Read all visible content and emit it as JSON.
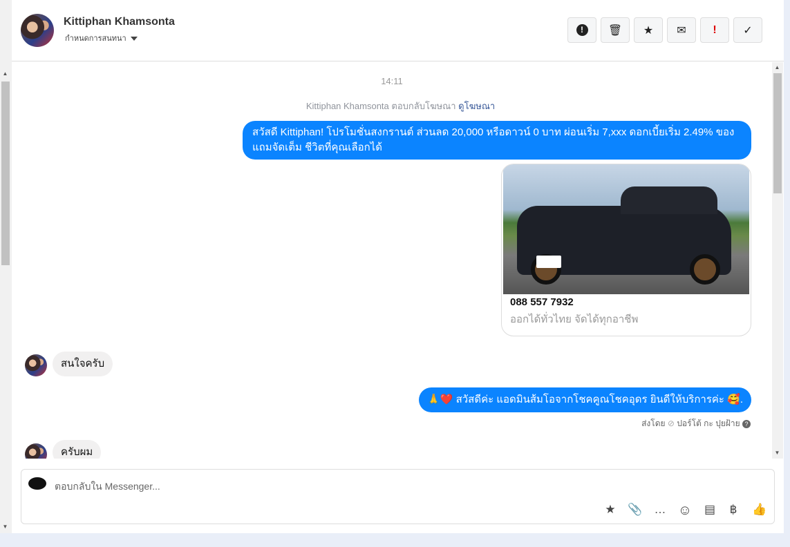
{
  "header": {
    "contact_name": "Kittiphan Khamsonta",
    "conversation_setting": "กำหนดการสนทนา",
    "toolbar": [
      {
        "name": "spam-button",
        "icon": "!",
        "label": "Mark as spam"
      },
      {
        "name": "delete-button",
        "icon": "🗑"
      },
      {
        "name": "star-button",
        "icon": "★"
      },
      {
        "name": "mark-unread-button",
        "icon": "✉"
      },
      {
        "name": "follow-up-button",
        "icon": "!"
      },
      {
        "name": "done-button",
        "icon": "✓"
      }
    ]
  },
  "conversation": {
    "timestamp": "14:11",
    "ad_reply_text": "Kittiphan Khamsonta ตอบกลับโฆษณา",
    "ad_link": "ดูโฆษณา",
    "msg1": "สวัสดี Kittiphan! โปรโมชั่นสงกรานต์ ส่วนลด 20,000 หรือดาวน์ 0 บาท ผ่อนเริ่ม 7,xxx ดอกเบี้ยเริ่ม 2.49% ของแถมจัดเต็ม ชีวิตที่คุณเลือกได้",
    "card": {
      "title": "088 557 7932",
      "description": "ออกได้ทั่วไทย จัดได้ทุกอาชีพ"
    },
    "msg2": "สนใจครับ",
    "msg3": "🙏❤️ สวัสดีค่ะ แอดมินส้มโอจากโชคคูณโชคอุดร ยินดีให้บริการค่ะ 🥰.",
    "sent_by_label": "ส่งโดย",
    "sent_by_name": "ปอร์โต้ กะ ปุยฝ้าย",
    "msg4": "ครับผม"
  },
  "composer": {
    "placeholder": "ตอบกลับใน Messenger...",
    "icons": {
      "saved_reply": "★",
      "attach": "📎",
      "chat": "…",
      "emoji": "☺",
      "template": "▤",
      "payment": "฿",
      "like": "👍"
    }
  },
  "colors": {
    "accent": "#0b84ff"
  }
}
